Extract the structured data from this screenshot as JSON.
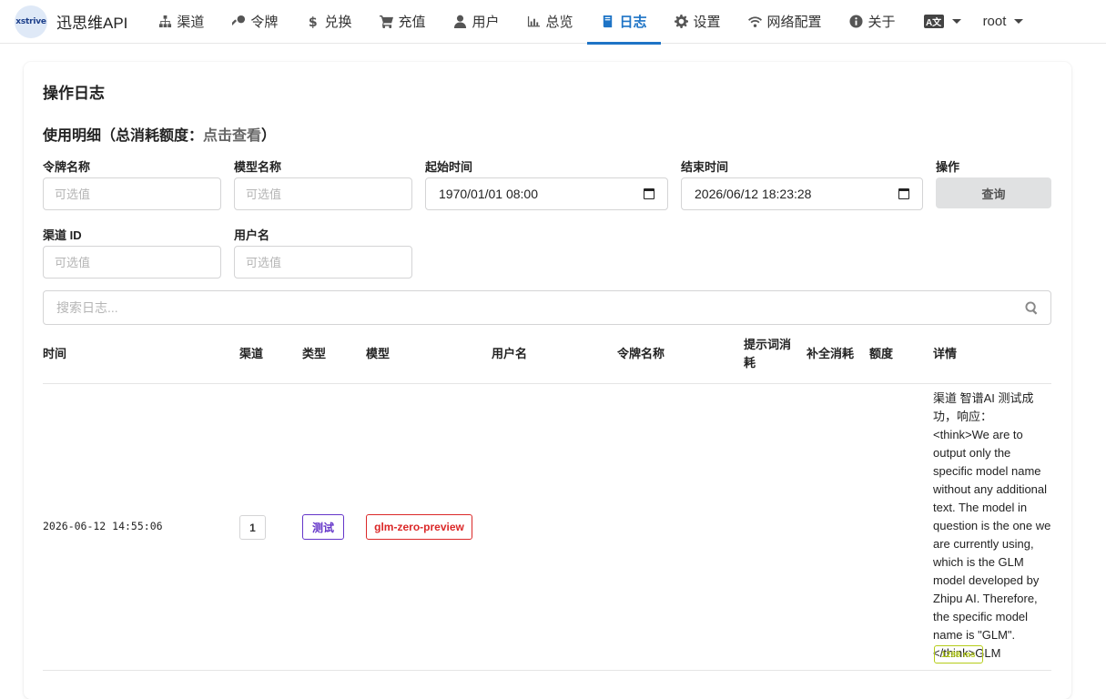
{
  "nav": {
    "brand_logo_text": "xstrive",
    "brand_name": "迅思维API",
    "items": [
      {
        "label": "渠道",
        "icon": "sitemap-icon"
      },
      {
        "label": "令牌",
        "icon": "key-icon"
      },
      {
        "label": "兑换",
        "icon": "dollar-icon"
      },
      {
        "label": "充值",
        "icon": "cart-icon"
      },
      {
        "label": "用户",
        "icon": "user-icon"
      },
      {
        "label": "总览",
        "icon": "bar-chart-icon"
      },
      {
        "label": "日志",
        "icon": "book-icon",
        "active": true
      },
      {
        "label": "设置",
        "icon": "gear-icon"
      },
      {
        "label": "网络配置",
        "icon": "wifi-icon"
      },
      {
        "label": "关于",
        "icon": "info-icon"
      }
    ],
    "language_icon": "language-icon",
    "user": "root"
  },
  "page": {
    "title": "操作日志",
    "usage_title_prefix": "使用明细（总消耗额度：",
    "usage_title_link": "点击查看",
    "usage_title_suffix": "）"
  },
  "filters": {
    "token_name": {
      "label": "令牌名称",
      "placeholder": "可选值",
      "value": ""
    },
    "model_name": {
      "label": "模型名称",
      "placeholder": "可选值",
      "value": ""
    },
    "start_time": {
      "label": "起始时间",
      "value": "1970/01/01 08:00"
    },
    "end_time": {
      "label": "结束时间",
      "value": "2026/06/12 18:23:28"
    },
    "action": {
      "label": "操作",
      "button": "查询"
    },
    "channel_id": {
      "label": "渠道 ID",
      "placeholder": "可选值",
      "value": ""
    },
    "username": {
      "label": "用户名",
      "placeholder": "可选值",
      "value": ""
    }
  },
  "search": {
    "placeholder": "搜索日志...",
    "value": ""
  },
  "table": {
    "headers": {
      "time": "时间",
      "channel": "渠道",
      "type": "类型",
      "model": "模型",
      "username": "用户名",
      "token_name": "令牌名称",
      "prompt_cost": "提示词消耗",
      "completion_cost": "补全消耗",
      "quota": "额度",
      "detail": "详情"
    },
    "rows": [
      {
        "time": "2026-06-12 14:55:06",
        "channel": "1",
        "type": "测试",
        "model": "glm-zero-preview",
        "username": "",
        "token_name": "",
        "prompt_cost": "",
        "completion_cost": "",
        "quota": "",
        "detail": "渠道 智谱AI 测试成功，响应： <think>We are to output only the specific model name without any additional text. The model in question is the one we are currently using, which is the GLM model developed by Zhipu AI. Therefore, the specific model name is \"GLM\". </think>GLM",
        "latency": "1288 ms"
      }
    ]
  },
  "colors": {
    "accent": "#1e74c6",
    "type_badge": "#6435c9",
    "model_badge": "#db2828",
    "latency_badge": "#b5cc18"
  }
}
